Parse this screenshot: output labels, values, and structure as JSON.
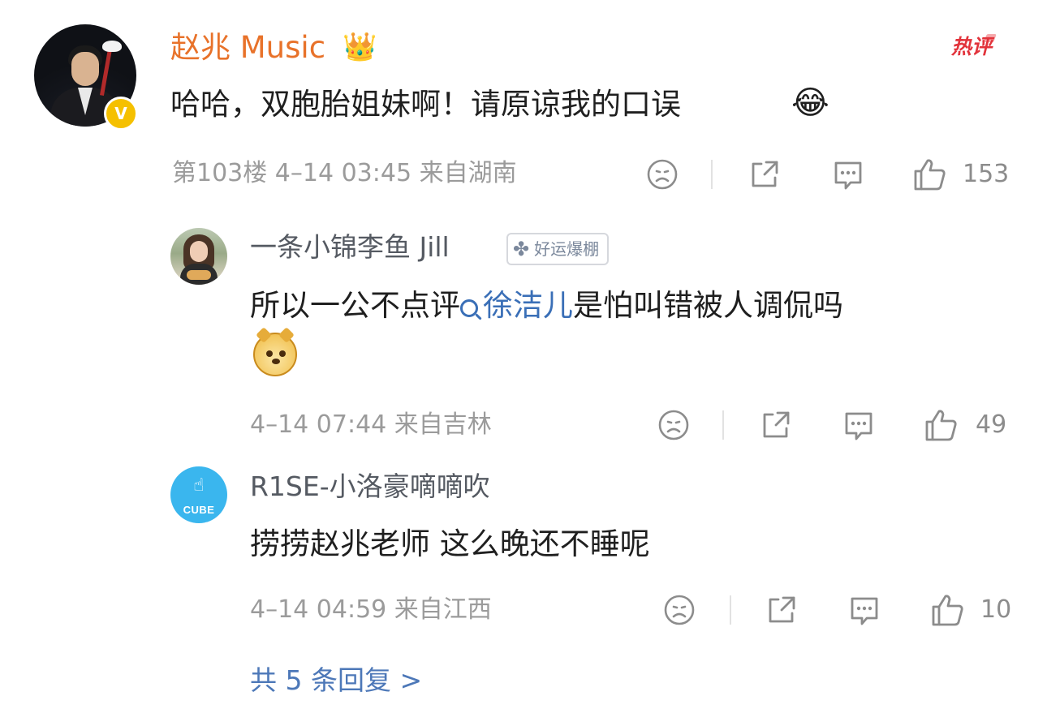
{
  "comment": {
    "author": "赵兆 Music",
    "hot_tag": "热评",
    "text": "哈哈，双胞胎姐妹啊！请原谅我的口误",
    "emoji": "😂",
    "meta": "第103楼  4–14 03:45  来自湖南",
    "likes": "153",
    "verified_mark": "V"
  },
  "replies": [
    {
      "author": "一条小锦李鱼 Jill",
      "badge": "好运爆棚",
      "text_before": "所以一公不点评",
      "mention": "徐洁儿",
      "text_after": "是怕叫错被人调侃吗",
      "meta": "4–14 07:44  来自吉林",
      "likes": "49"
    },
    {
      "author": "R1SE-小洛豪嘀嘀吹",
      "avatar_text": "CUBE",
      "text": "捞捞赵兆老师 这么晚还不睡呢",
      "meta": "4–14 04:59  来自江西",
      "likes": "10"
    }
  ],
  "more_replies": "共 5 条回复 >",
  "colors": {
    "username_main": "#e8722a",
    "hot": "#e2333b",
    "link": "#3a6fb7",
    "meta": "#9b9b9b"
  }
}
